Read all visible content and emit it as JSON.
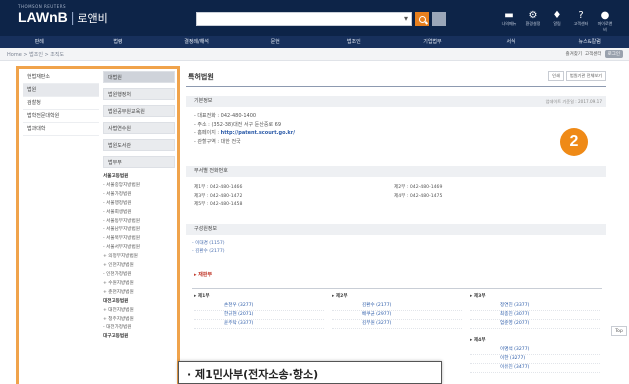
{
  "header": {
    "brand_small": "THOMSON REUTERS",
    "logo": "LAWnB",
    "logo_sub": "로앤비",
    "icons": [
      {
        "icon": "folder-icon",
        "label": "나의메뉴"
      },
      {
        "icon": "gear-icon",
        "label": "환경설정"
      },
      {
        "icon": "bell-icon",
        "label": "알림"
      },
      {
        "icon": "help-icon",
        "label": "고객센터"
      },
      {
        "icon": "user-icon",
        "label": "마이로앤비"
      }
    ]
  },
  "nav": [
    "판례",
    "법령",
    "결정례/해석",
    "문헌",
    "법조인",
    "기업법무",
    "서식",
    "뉴스&칼럼"
  ],
  "breadcrumb": "Home > 법조인 > 조직도",
  "crumb_right": [
    "즐겨찾기",
    "고객센터"
  ],
  "crumb_pill": "로그인",
  "left": {
    "col1": [
      "헌법재판소",
      "법원",
      "검찰청",
      "법학전문대학원",
      "법과대학"
    ],
    "col1_active": 1,
    "col2_boxes": [
      "대법원",
      "법원행정처",
      "법원공무원교육원",
      "사법연수원",
      "법원도서관",
      "법무부"
    ],
    "col2_active": 0,
    "tree": [
      {
        "t": "서울고등법원",
        "h": true
      },
      {
        "t": "- 서울중앙지방법원"
      },
      {
        "t": "- 서울가정법원"
      },
      {
        "t": "- 서울행정법원"
      },
      {
        "t": "- 서울회생법원"
      },
      {
        "t": "- 서울동부지방법원"
      },
      {
        "t": "- 서울남부지방법원"
      },
      {
        "t": "- 서울북부지방법원"
      },
      {
        "t": "- 서울서부지방법원"
      },
      {
        "t": "+ 의정부지방법원"
      },
      {
        "t": "+ 인천지방법원"
      },
      {
        "t": "- 인천가정법원"
      },
      {
        "t": "+ 수원지방법원"
      },
      {
        "t": "+ 춘천지방법원"
      },
      {
        "t": "대전고등법원",
        "h": true
      },
      {
        "t": "+ 대전지방법원"
      },
      {
        "t": "+ 청주지방법원"
      },
      {
        "t": "- 대전가정법원"
      },
      {
        "t": "대구고등법원",
        "h": true
      }
    ]
  },
  "main": {
    "title": "특허법원",
    "top_buttons": [
      "인쇄",
      "법원기관 전체보기"
    ],
    "basic_head": "기본정보",
    "basic_updated": "업데이트 기준일 : 2017.09.17",
    "basic_lines": [
      "- 대표전화 : 042-480-1400",
      "- 주소 : (352-38)대전 서구 둔산중로 69",
      "- 홈페이지 : ",
      "- 관할구역 : 대한 전국"
    ],
    "homepage": "http://patent.scourt.go.kr/",
    "badge": "2",
    "phone_head": "부서별 전화번호",
    "phones": [
      [
        "제1부 : 042-480-1466",
        "제2부 : 042-480-1469"
      ],
      [
        "제3부 : 042-480-1472",
        "제4부 : 042-480-1475"
      ],
      [
        "제5부 : 042-480-1458",
        ""
      ]
    ],
    "org_head": "구성원정보",
    "org": [
      "- 이대경 (1157)",
      "- 김환수 (2177)"
    ],
    "division": "▸ 재판부",
    "judges": [
      {
        "head": "▸ 제1부",
        "rows": [
          [
            "손천우 (3277)"
          ],
          [
            "한규현 (2071)"
          ],
          [
            "윤주탁 (3377)"
          ]
        ]
      },
      {
        "head": "▸ 제2부",
        "rows": [
          [
            "김환수 (2177)"
          ],
          [
            "배쿠균 (2977)"
          ],
          [
            "김부원 (3277)"
          ]
        ]
      },
      {
        "head": "▸ 제3부",
        "rows": [
          [
            "정연진 (3377)"
          ],
          [
            "최종진 (3077)"
          ],
          [
            "엄준영 (2077)"
          ]
        ]
      }
    ],
    "col4": [
      "▸ 제4부",
      "이명석 (3277)",
      "이한 (3277)",
      "이유진 (3477)"
    ]
  },
  "popup": "· 제1민사부(전자소송·항소)",
  "top_button": "Top"
}
